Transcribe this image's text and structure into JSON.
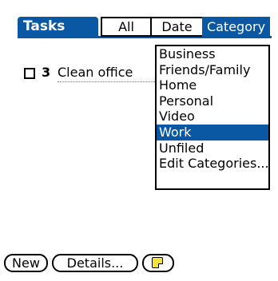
{
  "header": {
    "title": "Tasks",
    "filters": [
      "All",
      "Date",
      "Category"
    ],
    "selected_filter": "Category"
  },
  "tasks": [
    {
      "checked": false,
      "priority": "3",
      "description": "Clean office"
    }
  ],
  "category_menu": {
    "items": [
      "Business",
      "Friends/Family",
      "Home",
      "Personal",
      "Video",
      "Work",
      "Unfiled",
      "Edit Categories..."
    ],
    "selected": "Work"
  },
  "buttons": {
    "new_label": "New",
    "details_label": "Details...",
    "note_icon": "note-icon"
  },
  "colors": {
    "accent": "#0a57a4",
    "note_yellow": "#f4e23c"
  }
}
